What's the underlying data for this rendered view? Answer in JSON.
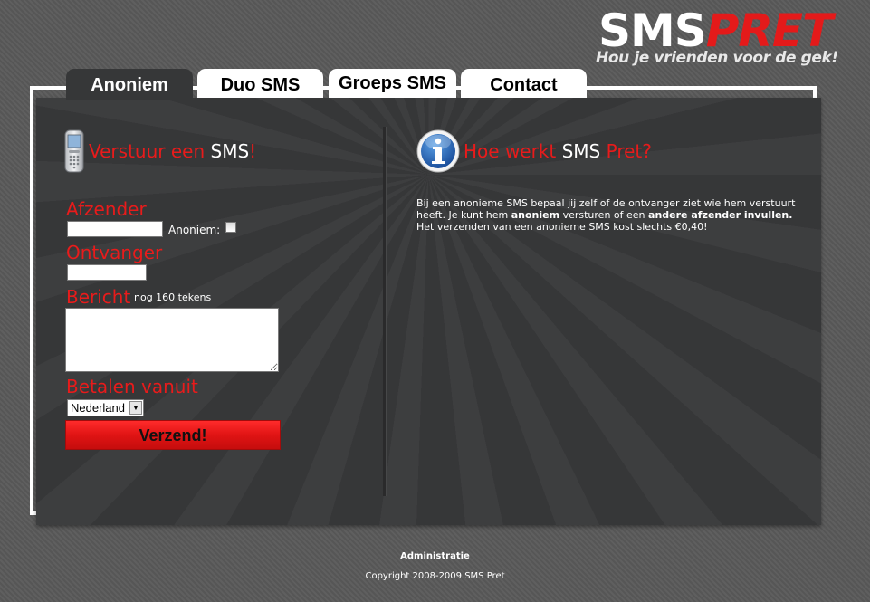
{
  "logo": {
    "main_white": "SMS",
    "main_red": "PRET",
    "tagline": "Hou je vrienden voor de gek!"
  },
  "tabs": [
    {
      "label": "Anoniem",
      "active": true
    },
    {
      "label": "Duo SMS",
      "active": false
    },
    {
      "label": "Groeps SMS",
      "active": false
    },
    {
      "label": "Contact",
      "active": false
    }
  ],
  "left": {
    "heading_part1": "Verstuur een ",
    "heading_part2": "SMS",
    "heading_part3": "!",
    "sender_label": "Afzender",
    "anonymous_label": "Anoniem:",
    "anonymous_checked": false,
    "sender_value": "",
    "receiver_label": "Ontvanger",
    "receiver_value": "",
    "message_label": "Bericht",
    "message_counter": "nog 160 tekens",
    "message_value": "",
    "pay_label": "Betalen vanuit",
    "pay_selected": "Nederland",
    "submit_label": "Verzend!"
  },
  "right": {
    "heading_part1": "Hoe werkt ",
    "heading_part2": "SMS",
    "heading_part3": " Pret?",
    "text_1": "Bij een anonieme SMS bepaal jij zelf of de ontvanger ziet wie hem verstuurt heeft. Je kunt hem ",
    "text_bold_1": "anoniem",
    "text_2": " versturen of een ",
    "text_bold_2": "andere afzender invullen.",
    "text_3": " Het verzenden van een anonieme SMS kost slechts €0,40!"
  },
  "footer": {
    "admin_link": "Administratie",
    "copyright": "Copyright 2008-2009 SMS Pret"
  },
  "colors": {
    "accent_red": "#e81b1b",
    "panel": "#363738",
    "background": "#595959"
  },
  "icons": {
    "phone": "mobile-phone-icon",
    "info": "info-icon",
    "dropdown": "chevron-down-icon"
  }
}
